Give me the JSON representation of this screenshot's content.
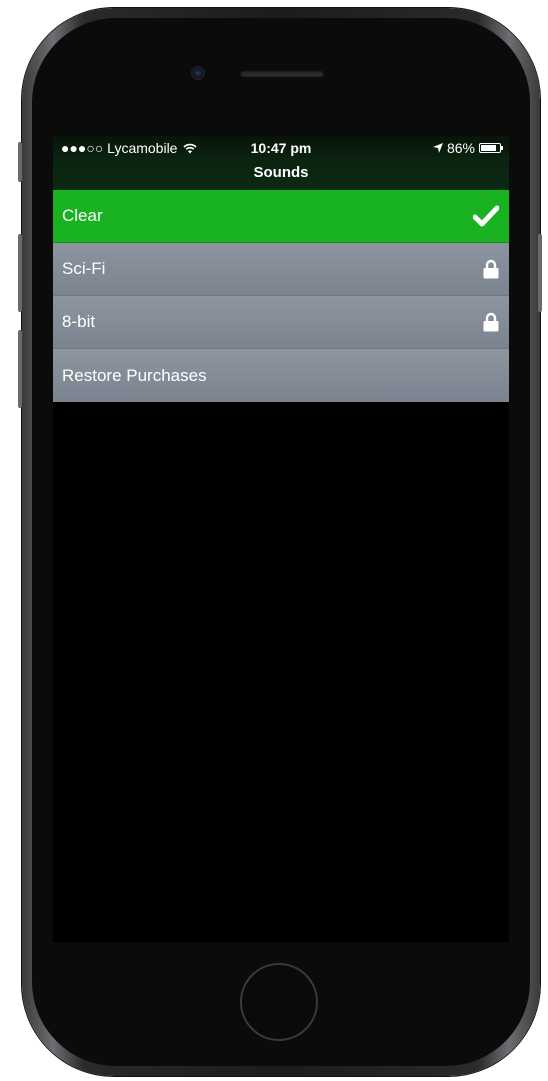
{
  "status_bar": {
    "signal": "●●●○○",
    "carrier": "Lycamobile",
    "wifi_icon": "wifi-icon",
    "time": "10:47 pm",
    "location_icon": "location-arrow-icon",
    "battery_percent": "86%",
    "battery_level": 0.86
  },
  "navbar": {
    "title": "Sounds"
  },
  "rows": [
    {
      "label": "Clear",
      "state": "selected",
      "icon": "checkmark-icon"
    },
    {
      "label": "Sci-Fi",
      "state": "locked",
      "icon": "lock-icon"
    },
    {
      "label": "8-bit",
      "state": "locked",
      "icon": "lock-icon"
    },
    {
      "label": "Restore Purchases",
      "state": "action"
    }
  ],
  "colors": {
    "selected_row": "#19b321",
    "row": "#848c98",
    "screen_background": "#000000",
    "text": "#ffffff"
  }
}
